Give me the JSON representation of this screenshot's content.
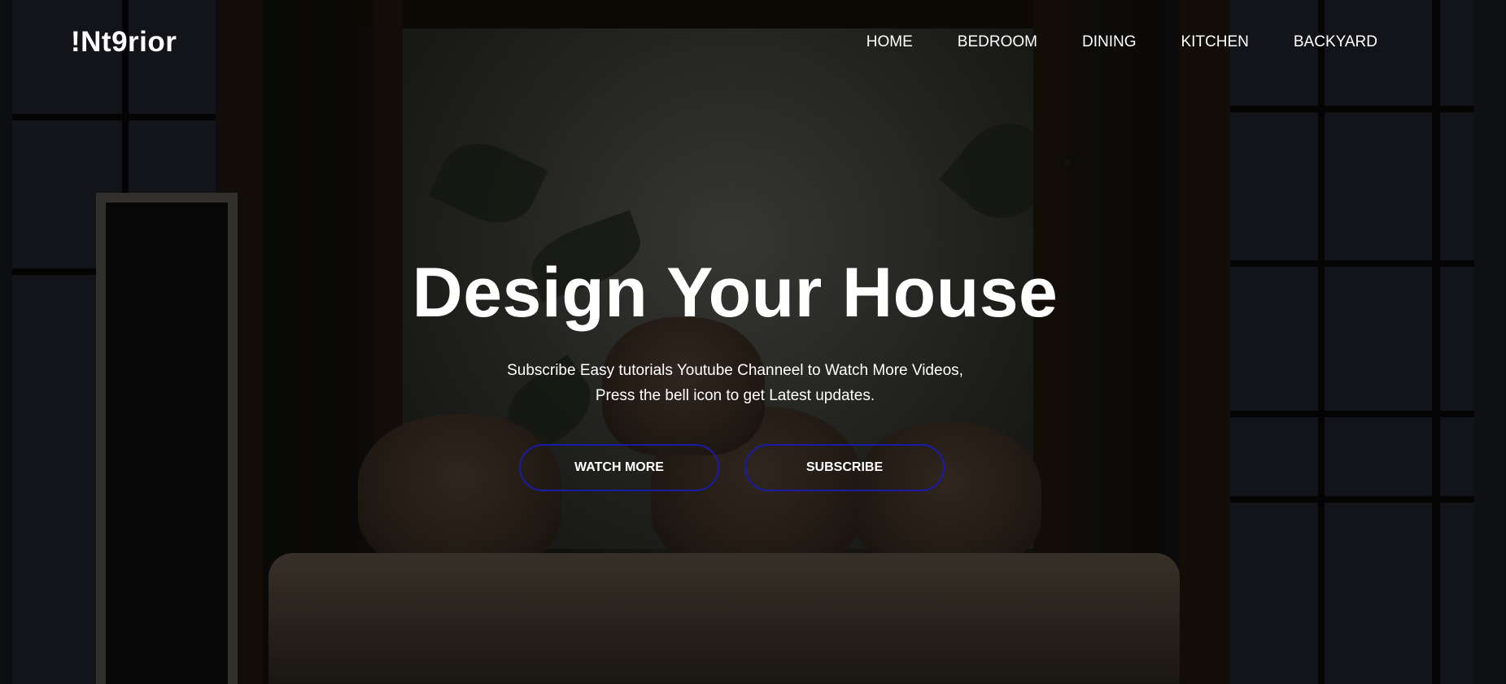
{
  "brand": {
    "logo": "!Nt9rior"
  },
  "nav": {
    "items": [
      {
        "label": "HOME"
      },
      {
        "label": "BEDROOM"
      },
      {
        "label": "DINING"
      },
      {
        "label": "KITCHEN"
      },
      {
        "label": "BACKYARD"
      }
    ]
  },
  "hero": {
    "title": "Design Your House",
    "subtitle_line1": "Subscribe Easy tutorials Youtube Channeel to Watch More Videos,",
    "subtitle_line2": "Press the bell icon to get Latest updates.",
    "buttons": {
      "watch_more": "WATCH MORE",
      "subscribe": "SUBSCRIBE"
    }
  },
  "colors": {
    "text": "#ffffff",
    "button_border": "#1b1ba8",
    "overlay": "rgba(0,0,0,0.55)"
  },
  "background": {
    "image": "dark-bedroom-photo"
  }
}
